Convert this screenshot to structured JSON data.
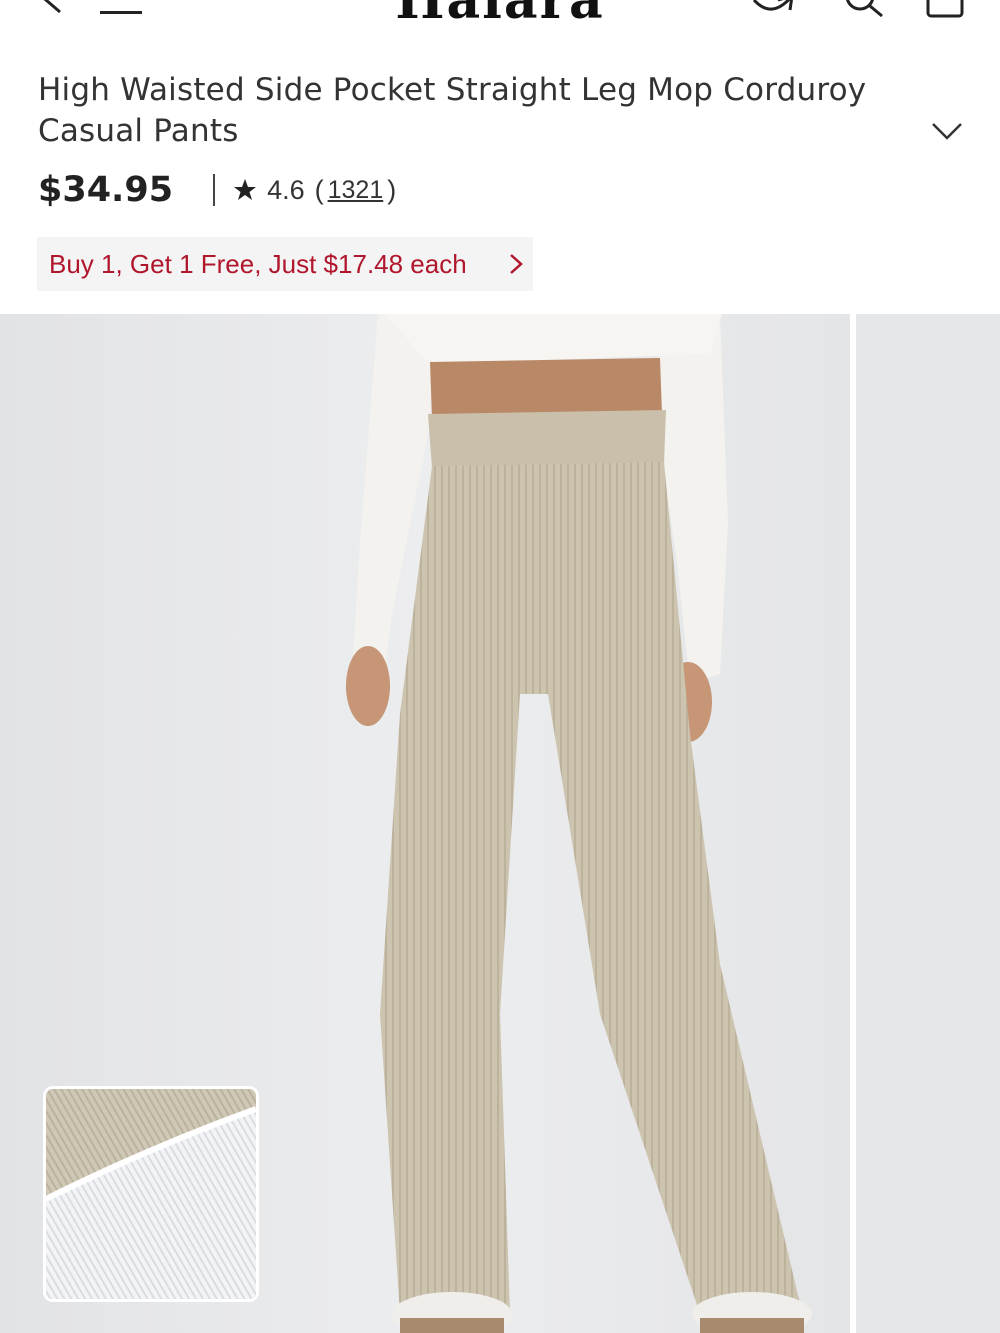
{
  "nav": {
    "brand": "Halara"
  },
  "product": {
    "title": "High Waisted Side Pocket Straight Leg Mop Corduroy Casual Pants",
    "price": "$34.95",
    "rating": "4.6",
    "review_count": "1321",
    "paren_open": "(",
    "paren_close": ")"
  },
  "promo": {
    "text": "Buy 1, Get 1 Free, Just $17.48 each"
  },
  "colors": {
    "promo_text": "#b0162c",
    "promo_bg": "#f4f4f4",
    "gallery_bg": "#e7e8ea",
    "pants": "#cdc4b0"
  },
  "icons": [
    "back-arrow-icon",
    "menu-icon",
    "share-icon",
    "search-icon",
    "cart-icon",
    "chevron-down-icon",
    "star-icon",
    "chevron-right-icon"
  ]
}
